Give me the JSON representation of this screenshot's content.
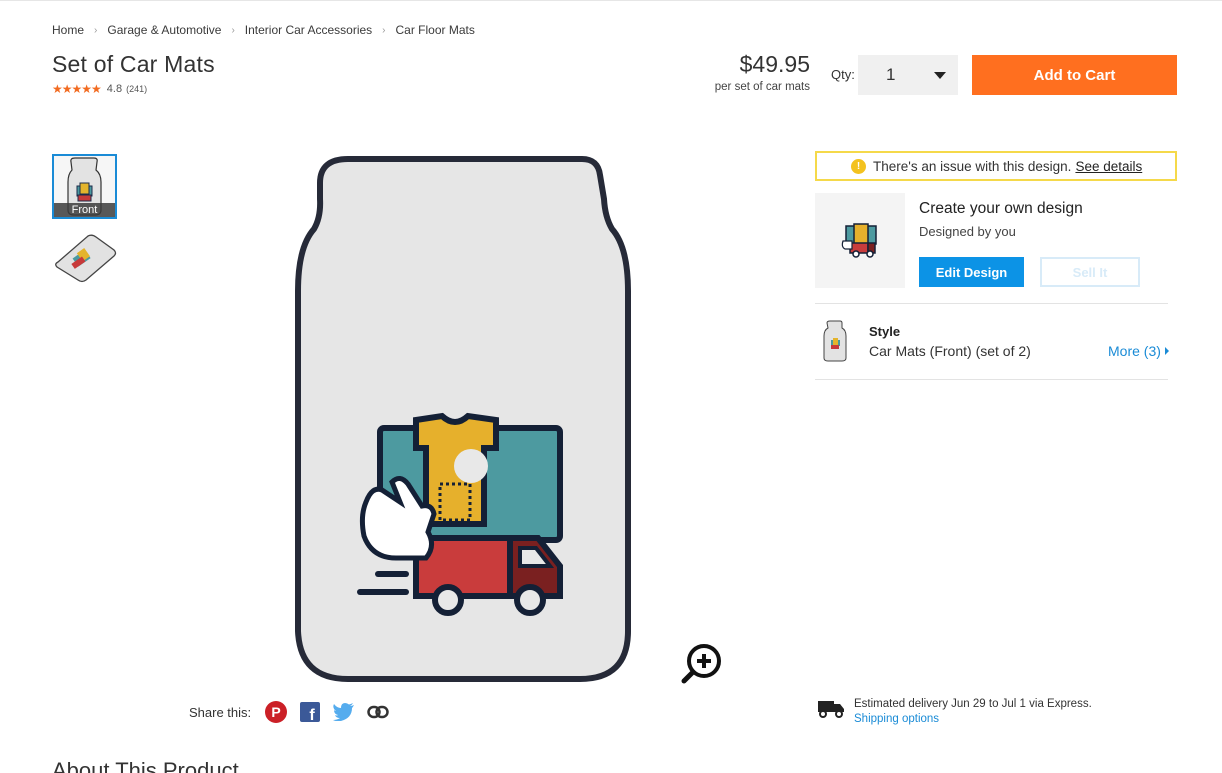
{
  "breadcrumb": {
    "items": [
      "Home",
      "Garage & Automotive",
      "Interior Car Accessories",
      "Car Floor Mats"
    ]
  },
  "product": {
    "title": "Set of Car Mats",
    "rating_score": "4.8",
    "rating_count": "(241)",
    "rating_fraction": 0.96,
    "price": "$49.95",
    "price_unit": "per set of car mats"
  },
  "purchase": {
    "qty_label": "Qty:",
    "qty_value": "1",
    "add_to_cart": "Add to Cart"
  },
  "gallery": {
    "thumbs": [
      {
        "label": "Front"
      },
      {
        "label": ""
      }
    ]
  },
  "share": {
    "label": "Share this:",
    "icons": [
      "pinterest-icon",
      "facebook-icon",
      "twitter-icon",
      "link-icon"
    ]
  },
  "about": {
    "heading": "About This Product"
  },
  "issue": {
    "text": "There's an issue with this design.",
    "link": "See details"
  },
  "create": {
    "title": "Create your own design",
    "subtitle": "Designed by you",
    "edit_label": "Edit Design",
    "sell_label": "Sell It"
  },
  "style": {
    "title": "Style",
    "value": "Car Mats (Front) (set of 2)",
    "more": "More (3)"
  },
  "delivery": {
    "text": "Estimated delivery Jun 29 to Jul 1 via Express.",
    "link": "Shipping options"
  },
  "colors": {
    "accent_orange": "#ff6f1f",
    "link_blue": "#1a8bd6",
    "edit_blue": "#0c93e6",
    "warning_border": "#f5d94a",
    "star": "#f26b21"
  }
}
